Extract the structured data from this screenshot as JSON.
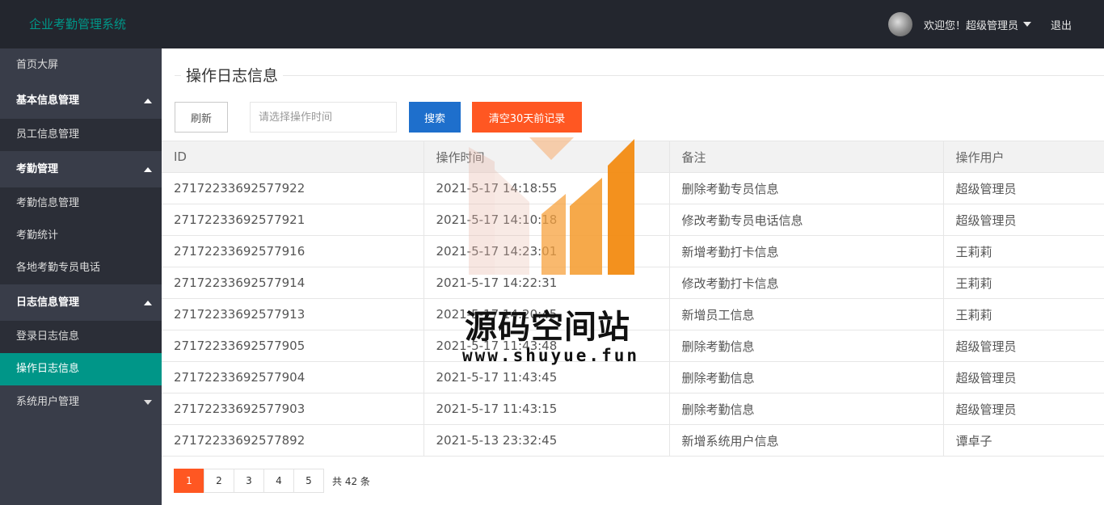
{
  "header": {
    "app_title": "企业考勤管理系统",
    "welcome": "欢迎您！超级管理员",
    "logout": "退出"
  },
  "sidebar": {
    "home": "首页大屏",
    "groups": [
      {
        "label": "基本信息管理",
        "items": [
          "员工信息管理"
        ]
      },
      {
        "label": "考勤管理",
        "items": [
          "考勤信息管理",
          "考勤统计",
          "各地考勤专员电话"
        ]
      },
      {
        "label": "日志信息管理",
        "items": [
          "登录日志信息",
          "操作日志信息"
        ]
      }
    ],
    "collapsed_group": "系统用户管理",
    "active_item": "操作日志信息"
  },
  "main": {
    "section_title": "操作日志信息",
    "refresh_label": "刷新",
    "search_placeholder": "请选择操作时间",
    "search_label": "搜索",
    "clear_label": "清空30天前记录"
  },
  "table": {
    "columns": [
      "ID",
      "操作时间",
      "备注",
      "操作用户"
    ],
    "rows": [
      [
        "27172233692577922",
        "2021-5-17 14:18:55",
        "删除考勤专员信息",
        "超级管理员"
      ],
      [
        "27172233692577921",
        "2021-5-17 14:10:18",
        "修改考勤专员电话信息",
        "超级管理员"
      ],
      [
        "27172233692577916",
        "2021-5-17 14:23:01",
        "新增考勤打卡信息",
        "王莉莉"
      ],
      [
        "27172233692577914",
        "2021-5-17 14:22:31",
        "修改考勤打卡信息",
        "王莉莉"
      ],
      [
        "27172233692577913",
        "2021-5-17 14:20:45",
        "新增员工信息",
        "王莉莉"
      ],
      [
        "27172233692577905",
        "2021-5-17 11:43:48",
        "删除考勤信息",
        "超级管理员"
      ],
      [
        "27172233692577904",
        "2021-5-17 11:43:45",
        "删除考勤信息",
        "超级管理员"
      ],
      [
        "27172233692577903",
        "2021-5-17 11:43:15",
        "删除考勤信息",
        "超级管理员"
      ],
      [
        "27172233692577892",
        "2021-5-13 23:32:45",
        "新增系统用户信息",
        "谭卓子"
      ]
    ]
  },
  "pagination": {
    "pages": [
      "1",
      "2",
      "3",
      "4",
      "5"
    ],
    "current": "1",
    "total_text": "共 42 条"
  },
  "watermark": {
    "title": "源码空间站",
    "url": "www.shuyue.fun"
  },
  "colors": {
    "header_bg": "#23262e",
    "sidebar_bg": "#393d49",
    "sidebar_sub_bg": "#2b2e37",
    "accent_green": "#009688",
    "search_blue": "#1e6fcc",
    "danger_orange": "#ff5722"
  }
}
